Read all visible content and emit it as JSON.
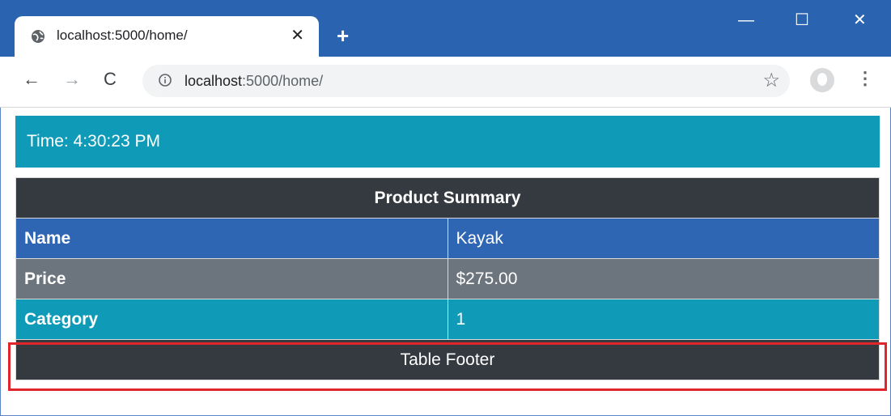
{
  "browser": {
    "tab_title": "localhost:5000/home/",
    "tab_close_glyph": "✕",
    "new_tab_glyph": "+",
    "window_controls": {
      "minimize": "—",
      "maximize": "☐",
      "close": "✕"
    },
    "nav": {
      "back": "←",
      "forward": "→",
      "reload": "C"
    },
    "url_host": "localhost",
    "url_path": ":5000/home/",
    "star_glyph": "☆",
    "menu_glyph": "⋮",
    "icons": [
      "globe-icon",
      "info-icon",
      "star-icon",
      "profile-icon",
      "menu-icon"
    ]
  },
  "page": {
    "time_text": "Time: 4:30:23 PM",
    "table": {
      "title": "Product Summary",
      "rows": [
        {
          "label": "Name",
          "value": "Kayak"
        },
        {
          "label": "Price",
          "value": "$275.00"
        },
        {
          "label": "Category",
          "value": "1"
        }
      ],
      "footer": "Table Footer"
    }
  },
  "colors": {
    "titlebar": "#2a63b0",
    "time_bar": "#0f9bb8",
    "table_header": "#343a40",
    "row_name": "#2f66b3",
    "row_price": "#6c757d",
    "row_category": "#0f9bb8",
    "highlight": "#e0252b"
  }
}
